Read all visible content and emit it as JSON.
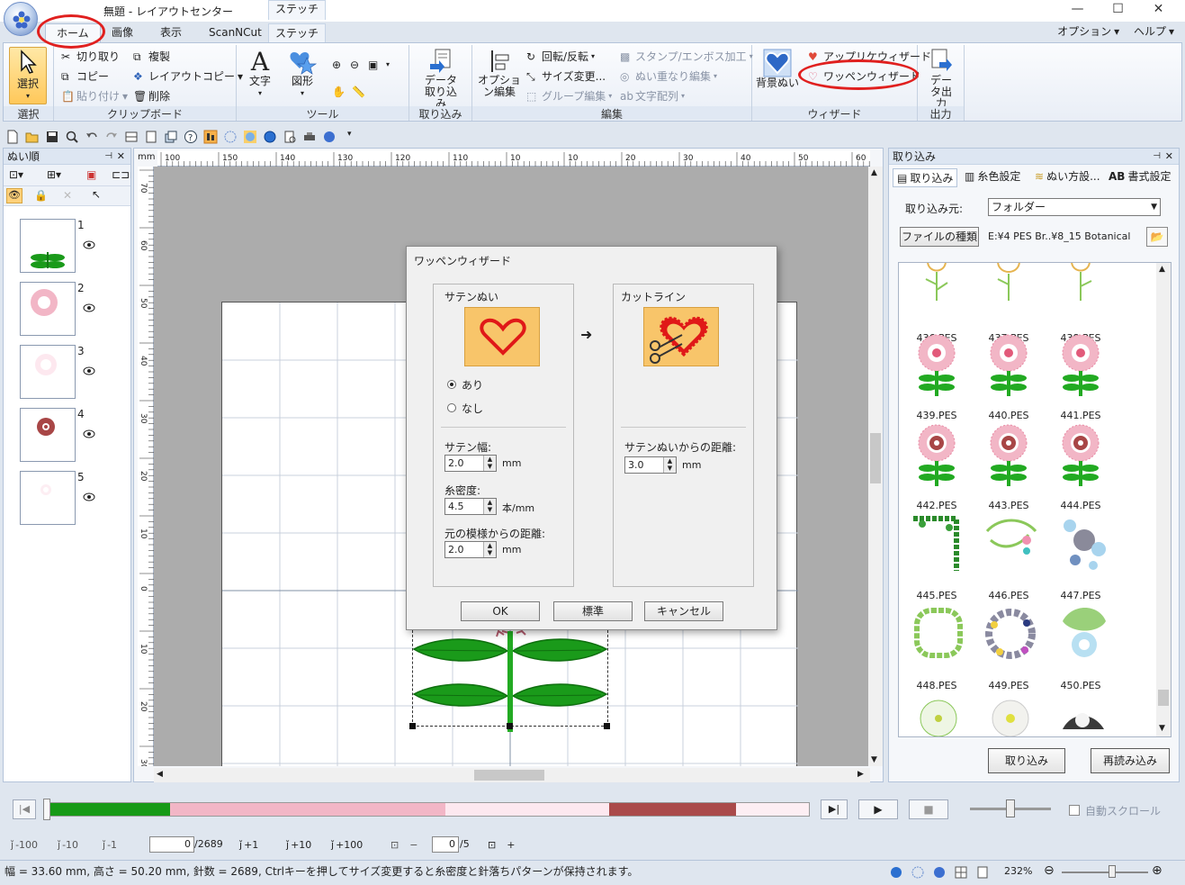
{
  "window": {
    "title": "無題 - レイアウトセンター",
    "context_tab_header": "ステッチ",
    "controls": [
      "—",
      "☐",
      "✕"
    ]
  },
  "ribbon_tabs": [
    "ホーム",
    "画像",
    "表示",
    "ScanNCut",
    "ステッチ"
  ],
  "top_menu": [
    "オプション",
    "ヘルプ"
  ],
  "ribbon": {
    "select": {
      "label": "選択",
      "group": "選択"
    },
    "clipboard": {
      "cut": "切り取り",
      "copy": "コピー",
      "paste": "貼り付け",
      "duplicate": "複製",
      "layout_copy": "レイアウトコピー",
      "delete": "削除",
      "group": "クリップボード"
    },
    "tools": {
      "text": "文字",
      "shape": "図形",
      "group": "ツール"
    },
    "import": {
      "label": "データ取り込み",
      "group": "取り込み"
    },
    "edit": {
      "option_edit": "オプション編集",
      "rotate_flip": "回転/反転",
      "size_change": "サイズ変更...",
      "group_edit": "グループ編集",
      "stamp_emboss": "スタンプ/エンボス加工",
      "stitch_overlap": "ぬい重なり編集",
      "text_arrange": "文字配列",
      "group": "編集"
    },
    "wizard": {
      "background": "背景ぬい",
      "applique": "アップリケウィザード",
      "patch": "ワッペンウィザード",
      "group": "ウィザード"
    },
    "output": {
      "label": "データ出力",
      "group": "出力"
    }
  },
  "left_pane": {
    "title": "ぬい順",
    "layers": [
      "1",
      "2",
      "3",
      "4",
      "5"
    ]
  },
  "rulers": {
    "h_labels": [
      "100",
      "150",
      "140",
      "130",
      "120",
      "110",
      "10",
      "10",
      "20",
      "30",
      "40",
      "50",
      "60"
    ],
    "v_labels": [
      "70",
      "60",
      "50",
      "40",
      "30",
      "20",
      "10",
      "0",
      "10",
      "20",
      "30"
    ]
  },
  "dialog": {
    "title": "ワッペンウィザード",
    "satin_frame_title": "サテンぬい",
    "cutline_frame_title": "カットライン",
    "radio_on": "あり",
    "radio_off": "なし",
    "satin_width_label": "サテン幅:",
    "satin_width_value": "2.0",
    "density_label": "糸密度:",
    "density_value": "4.5",
    "density_unit": "本/mm",
    "offset_label": "元の模様からの距離:",
    "offset_value": "2.0",
    "cut_distance_label": "サテンぬいからの距離:",
    "cut_distance_value": "3.0",
    "unit_mm": "mm",
    "ok": "OK",
    "default": "標準",
    "cancel": "キャンセル"
  },
  "right_pane": {
    "title": "取り込み",
    "tabs": [
      "取り込み",
      "糸色設定",
      "ぬい方設...",
      "書式設定"
    ],
    "source_label": "取り込み元:",
    "source_value": "フォルダー",
    "file_type_button": "ファイルの種類",
    "path": "E:¥4 PES  Br..¥8_15 Botanical",
    "files": [
      "436.PES",
      "437.PES",
      "438.PES",
      "439.PES",
      "440.PES",
      "441.PES",
      "442.PES",
      "443.PES",
      "444.PES",
      "445.PES",
      "446.PES",
      "447.PES",
      "448.PES",
      "449.PES",
      "450.PES"
    ],
    "import_button": "取り込み",
    "reload_button": "再読み込み"
  },
  "player": {
    "colors": [
      {
        "color": "#169a16",
        "share": 0.158
      },
      {
        "color": "#f2b6c6",
        "share": 0.363
      },
      {
        "color": "#fde8ef",
        "share": 0.216
      },
      {
        "color": "#aa4a4a",
        "share": 0.167
      },
      {
        "color": "#fdeef3",
        "share": 0.096
      }
    ],
    "auto_scroll": "自動スクロール"
  },
  "step_bar": {
    "minus100": "-100",
    "minus10": "-10",
    "minus1": "-1",
    "current_stitch": "0",
    "total_stitches": "/2689",
    "plus1": "+1",
    "plus10": "+10",
    "plus100": "+100",
    "minus": "−",
    "current_color": "0",
    "total_colors": "/5",
    "plus": "+"
  },
  "status": {
    "text": "幅 = 33.60 mm, 高さ = 50.20 mm, 針数 = 2689, Ctrlキーを押してサイズ変更すると糸密度と針落ちパターンが保持されます。",
    "zoom": "232%"
  }
}
